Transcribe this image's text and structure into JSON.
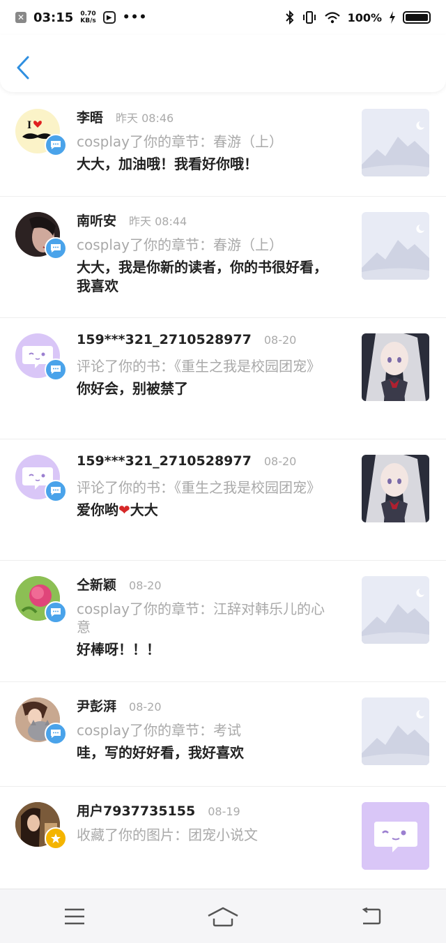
{
  "status_bar": {
    "time": "03:15",
    "speed_value": "0.70",
    "speed_unit": "KB/s",
    "dots": "•••",
    "battery": "100%"
  },
  "header": {
    "back_icon": "chevron-left-icon"
  },
  "items": [
    {
      "name": "李晤",
      "time": "昨天 08:46",
      "action": "cosplay了你的章节：春游（上）",
      "comment": "大大，加油哦！我看好你哦！",
      "badge": "chat-icon",
      "thumb": "mountain-placeholder"
    },
    {
      "name": "南听安",
      "time": "昨天 08:44",
      "action": "cosplay了你的章节：春游（上）",
      "comment": "大大，我是你新的读者，你的书很好看，我喜欢",
      "badge": "chat-icon",
      "thumb": "mountain-placeholder"
    },
    {
      "name": "159***321_2710528977",
      "time": "08-20",
      "action": "评论了你的书：《重生之我是校园团宠》",
      "comment": "你好会，别被禁了",
      "badge": "chat-icon",
      "thumb": "anime-girl-image"
    },
    {
      "name": "159***321_2710528977",
      "time": "08-20",
      "action": "评论了你的书：《重生之我是校园团宠》",
      "comment_prefix": "爱你哟",
      "comment_emoji": "❤",
      "comment_suffix": "大大",
      "badge": "chat-icon",
      "thumb": "anime-girl-image"
    },
    {
      "name": "仝新颖",
      "time": "08-20",
      "action": "cosplay了你的章节：江辞对韩乐儿的心意",
      "comment": "好棒呀！！！",
      "badge": "chat-icon",
      "thumb": "mountain-placeholder"
    },
    {
      "name": "尹彭湃",
      "time": "08-20",
      "action": "cosplay了你的章节：考试",
      "comment": "哇，写的好好看，我好喜欢",
      "badge": "chat-icon",
      "thumb": "mountain-placeholder"
    },
    {
      "name": "用户7937735155",
      "time": "08-19",
      "action": "收藏了你的图片：团宠小说文",
      "comment": "",
      "badge": "star-icon",
      "thumb": "chat-bubble-placeholder"
    }
  ],
  "colors": {
    "accent": "#4aa3ea",
    "muted": "#a9a9a9",
    "heart": "#d62828",
    "purple": "#d9c6f7"
  },
  "nav_bar": {
    "menu": "menu-icon",
    "home": "home-icon",
    "back": "back-icon"
  }
}
